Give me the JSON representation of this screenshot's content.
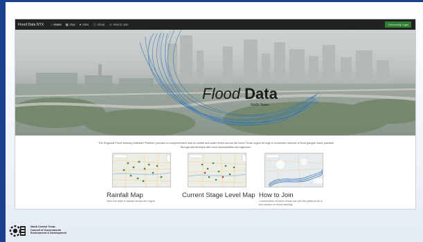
{
  "navbar": {
    "brand": "Flood Data NTX",
    "items": [
      {
        "label": "Home",
        "icon": "home-icon",
        "glyph": "⌂",
        "active": true
      },
      {
        "label": "Map",
        "icon": "map-icon",
        "glyph": "▦",
        "active": false
      },
      {
        "label": "Sites",
        "icon": "pin-icon",
        "glyph": "●",
        "active": false
      },
      {
        "label": "About",
        "icon": "info-icon",
        "glyph": "ⓘ",
        "active": false
      },
      {
        "label": "How to Join",
        "icon": "users-icon",
        "glyph": "☺",
        "active": false
      }
    ],
    "login_label": "Community Login"
  },
  "hero": {
    "title_part1": "Flood ",
    "title_part2": "Data",
    "subtitle": "North Texas",
    "colors": {
      "swirl": "#2b6cb0",
      "swirl_light": "#5f9ad6"
    }
  },
  "intro": {
    "text": "The Regional Flood Warning Software Platform provides a comprehensive look at rainfall and water levels across the North Texas region through a connected network of flood gauges made possible through partnerships with local municipalities and agencies."
  },
  "cards": [
    {
      "title": "Rainfall Map",
      "description": "View live data of rainfall across the region."
    },
    {
      "title": "Current Stage Level Map",
      "description": ""
    },
    {
      "title": "How to Join",
      "description": "Communities of North Texas can join the platform for a tool section on flood warning."
    }
  ],
  "footer_logo": {
    "line1": "North Central Texas",
    "line2": "Council of Governments",
    "line3": "Environment & Development"
  },
  "colors": {
    "accent": "#1c3f8f",
    "navbar": "#222222",
    "login_button": "#2e7d32"
  }
}
